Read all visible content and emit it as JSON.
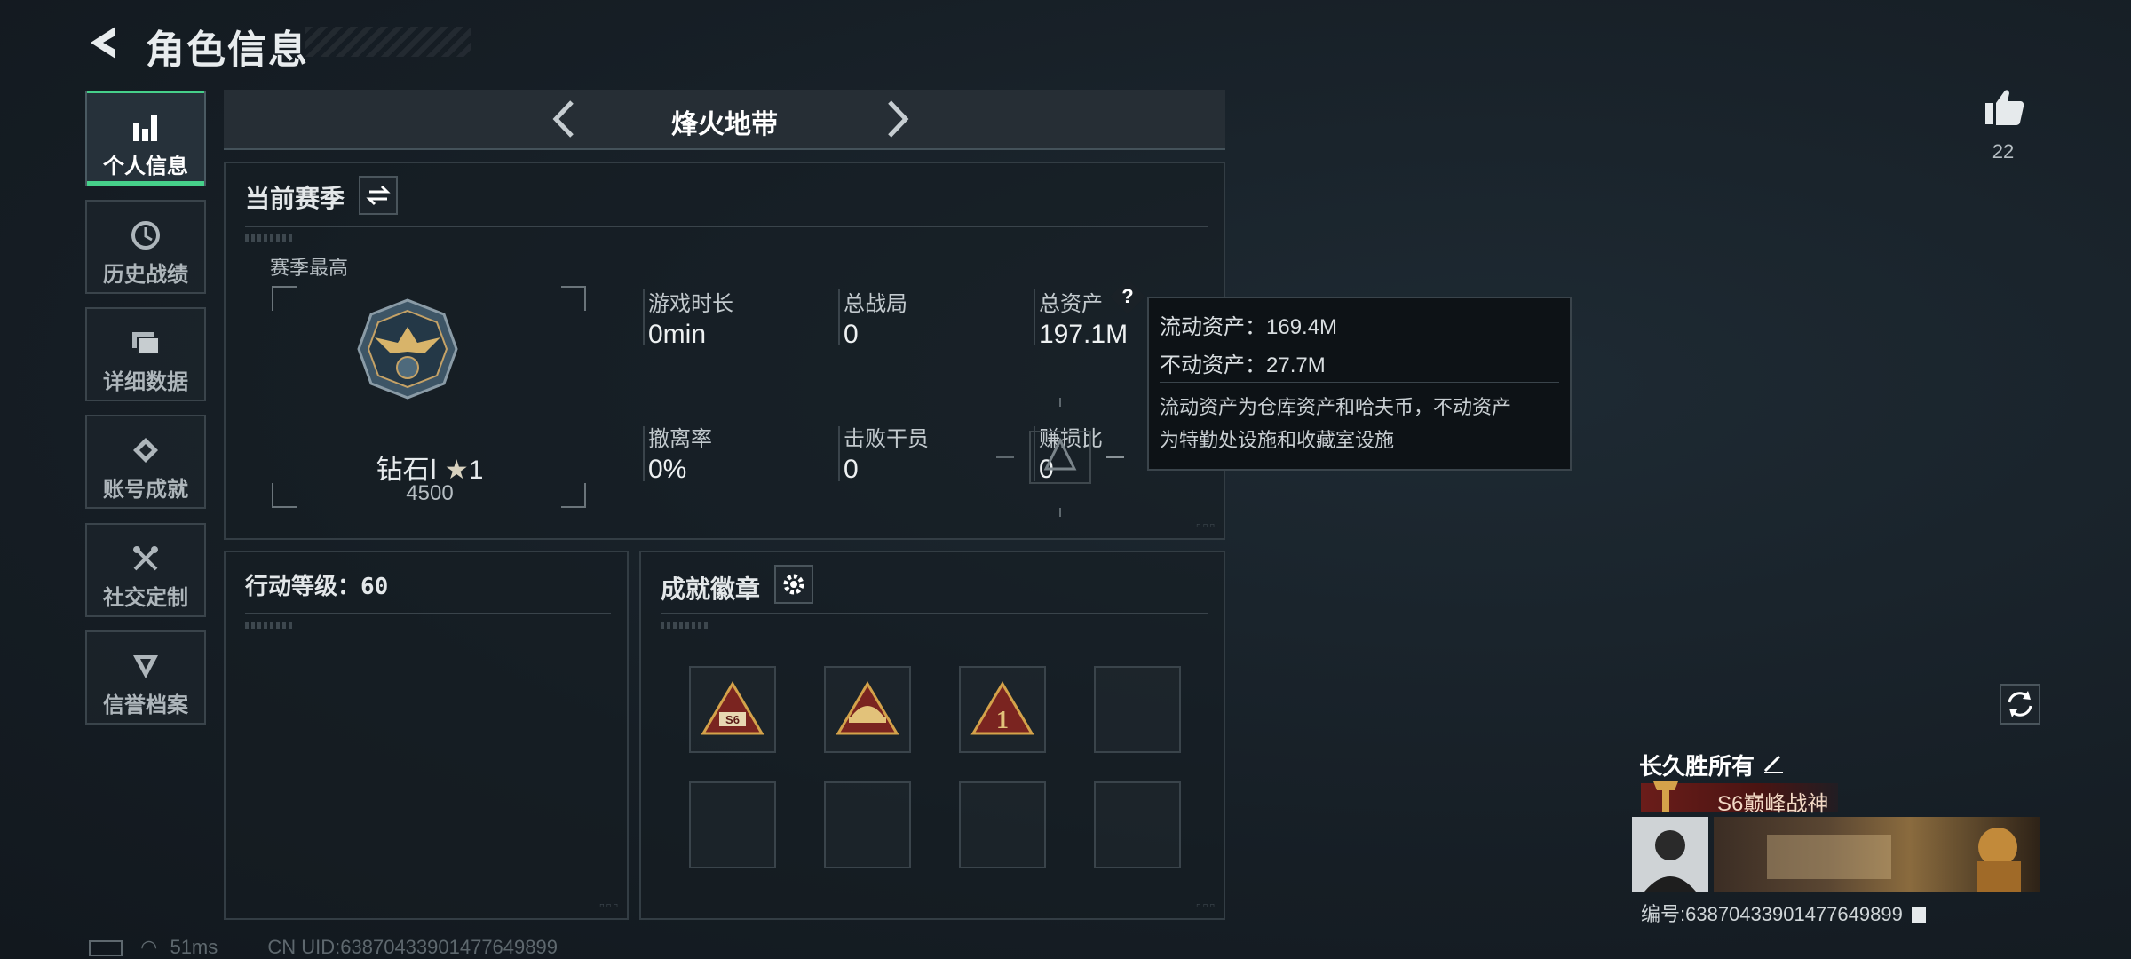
{
  "header": {
    "title": "角色信息"
  },
  "sidebar": {
    "items": [
      {
        "label": "个人信息",
        "icon": "bar-chart-icon",
        "active": true
      },
      {
        "label": "历史战绩",
        "icon": "history-icon",
        "active": false
      },
      {
        "label": "详细数据",
        "icon": "folder-icon",
        "active": false
      },
      {
        "label": "账号成就",
        "icon": "achievement-icon",
        "active": false
      },
      {
        "label": "社交定制",
        "icon": "tools-icon",
        "active": false
      },
      {
        "label": "信誉档案",
        "icon": "reputation-icon",
        "active": false
      }
    ]
  },
  "mode": {
    "title": "烽火地带"
  },
  "season": {
    "title": "当前赛季",
    "best_label": "赛季最高",
    "rank_name": "钻石Ⅰ",
    "rank_stars": "1",
    "rank_points": "4500",
    "stats": [
      {
        "label": "游戏时长",
        "value": "0min"
      },
      {
        "label": "总战局",
        "value": "0"
      },
      {
        "label": "总资产",
        "value": "197.1M"
      },
      {
        "label": "撤离率",
        "value": "0%"
      },
      {
        "label": "击败干员",
        "value": "0"
      },
      {
        "label": "赚损比",
        "value": "0"
      }
    ],
    "help_symbol": "?"
  },
  "tooltip": {
    "liquid": "流动资产：169.4M",
    "fixed": "不动资产：27.7M",
    "desc_line1": "流动资产为仓库资产和哈夫币，不动资产",
    "desc_line2": "为特勤处设施和收藏室设施"
  },
  "action_level": {
    "label": "行动等级：60"
  },
  "badges": {
    "title": "成就徽章",
    "slots": [
      {
        "icon": "s6-badge-icon",
        "text": "S6"
      },
      {
        "icon": "helmet-badge-icon",
        "text": ""
      },
      {
        "icon": "rank-one-badge-icon",
        "text": "1"
      },
      {
        "icon": "",
        "text": ""
      },
      {
        "icon": "",
        "text": ""
      },
      {
        "icon": "",
        "text": ""
      },
      {
        "icon": "",
        "text": ""
      },
      {
        "icon": "",
        "text": ""
      }
    ]
  },
  "likes": {
    "count": "22"
  },
  "player": {
    "name": "长久胜所有",
    "title": "S6巅峰战神",
    "id": "编号:63870433901477649899"
  },
  "footer": {
    "ping": "51ms",
    "uid": "CN UID:63870433901477649899"
  },
  "colors": {
    "accent": "#46d08a",
    "badge_red": "#8a2a24",
    "badge_gold": "#d4a24a"
  }
}
